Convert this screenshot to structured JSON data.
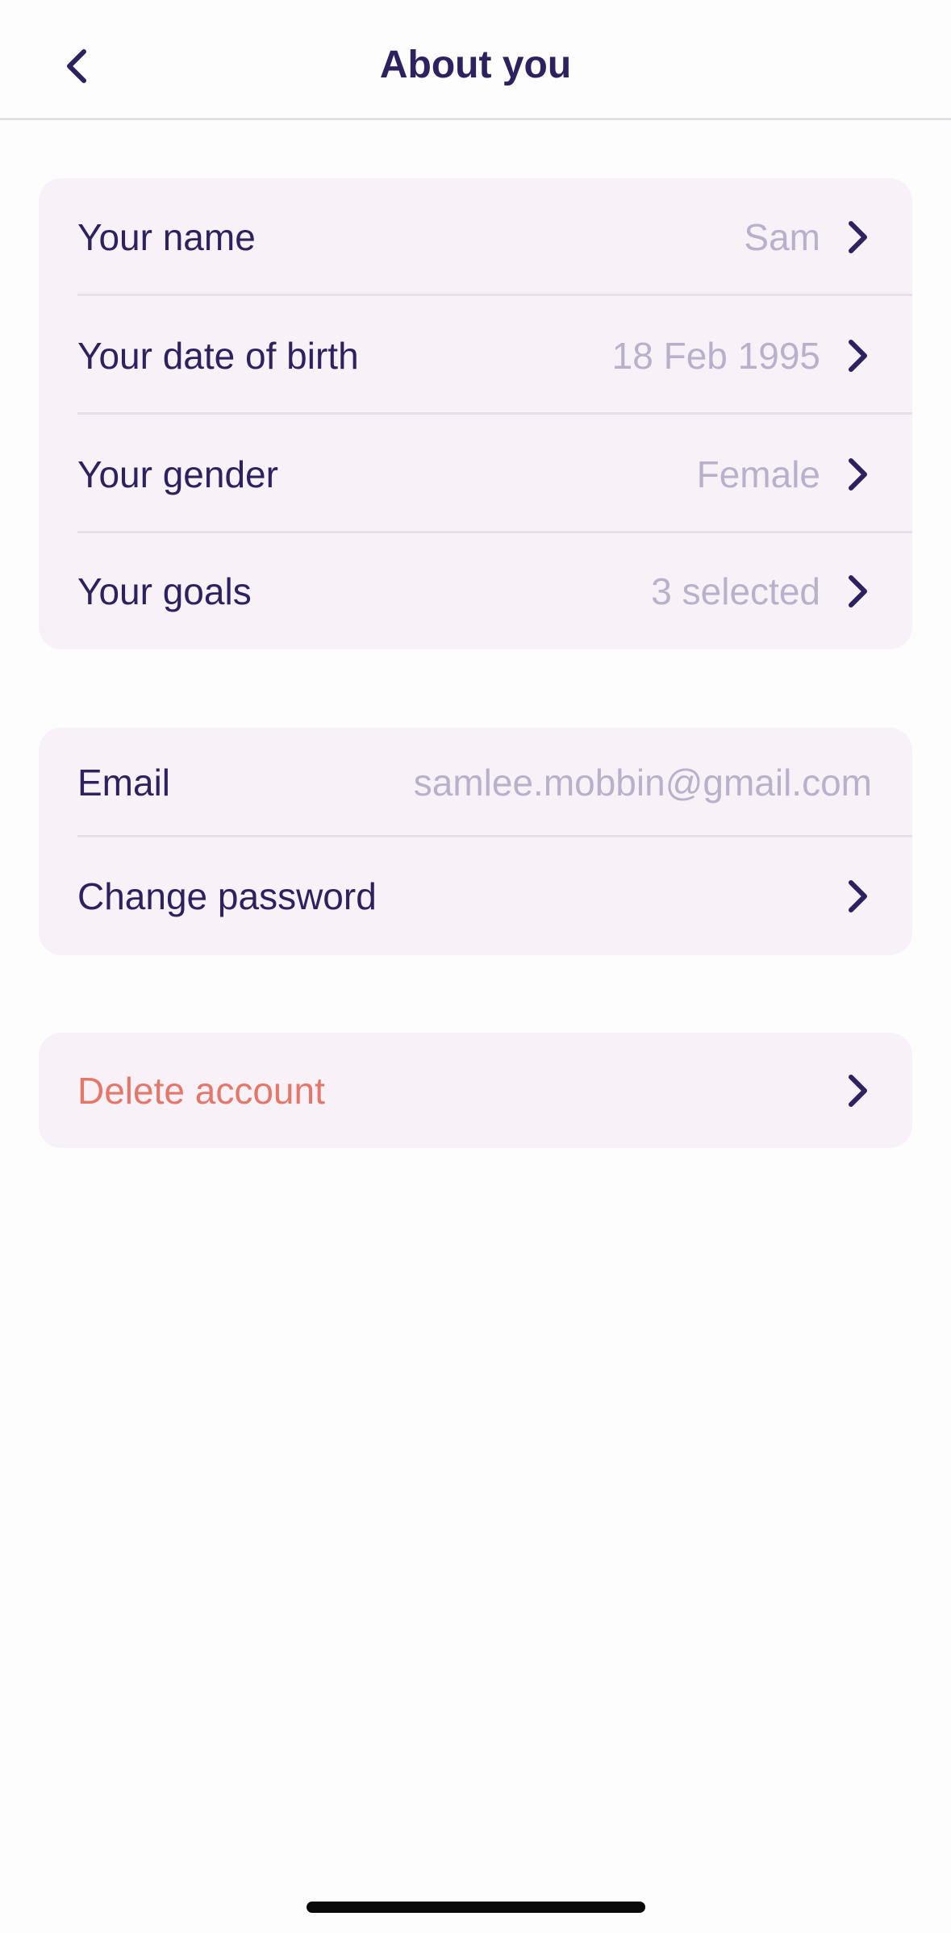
{
  "header": {
    "title": "About you"
  },
  "profile_section": {
    "rows": [
      {
        "label": "Your name",
        "value": "Sam"
      },
      {
        "label": "Your date of birth",
        "value": "18 Feb 1995"
      },
      {
        "label": "Your gender",
        "value": "Female"
      },
      {
        "label": "Your goals",
        "value": "3 selected"
      }
    ]
  },
  "account_section": {
    "email_label": "Email",
    "email_value": "samlee.mobbin@gmail.com",
    "password_label": "Change password"
  },
  "danger_section": {
    "delete_label": "Delete account"
  },
  "colors": {
    "primary_text": "#2d2160",
    "muted_text": "#b9b0cb",
    "card_bg": "#f8f2f8",
    "danger": "#e5766a"
  }
}
